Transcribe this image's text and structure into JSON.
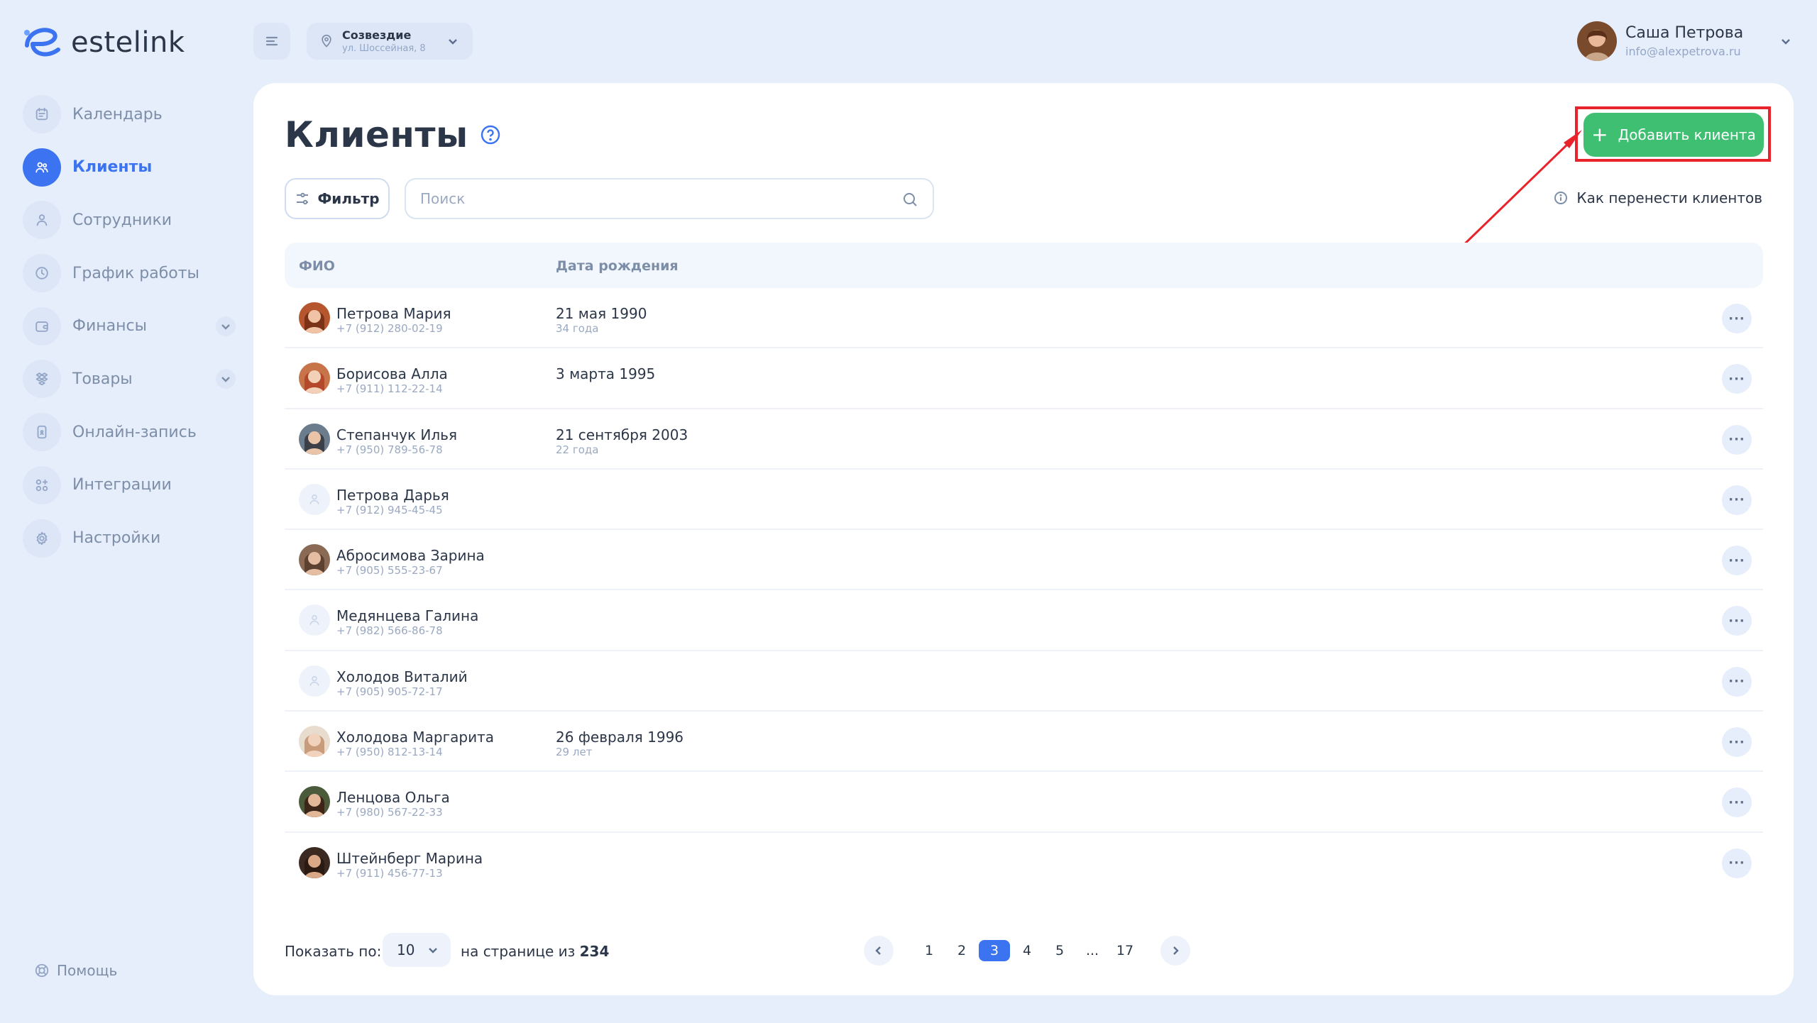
{
  "app": {
    "name": "estelink"
  },
  "sidebar": {
    "items": [
      {
        "label": "Календарь",
        "icon": "calendar-icon",
        "active": false,
        "expandable": false
      },
      {
        "label": "Клиенты",
        "icon": "users-icon",
        "active": true,
        "expandable": false
      },
      {
        "label": "Сотрудники",
        "icon": "user-icon",
        "active": false,
        "expandable": false
      },
      {
        "label": "График работы",
        "icon": "clock-icon",
        "active": false,
        "expandable": false
      },
      {
        "label": "Финансы",
        "icon": "wallet-icon",
        "active": false,
        "expandable": true
      },
      {
        "label": "Товары",
        "icon": "products-icon",
        "active": false,
        "expandable": true
      },
      {
        "label": "Онлайн-запись",
        "icon": "phone-icon",
        "active": false,
        "expandable": false
      },
      {
        "label": "Интеграции",
        "icon": "grid-plus-icon",
        "active": false,
        "expandable": false
      },
      {
        "label": "Настройки",
        "icon": "gear-icon",
        "active": false,
        "expandable": false
      }
    ],
    "help_label": "Помощь"
  },
  "header": {
    "location_name": "Созвездие",
    "location_address": "ул. Шоссейная, 8",
    "user_name": "Саша Петрова",
    "user_email": "info@alexpetrova.ru"
  },
  "page": {
    "title": "Клиенты",
    "add_button_label": "Добавить клиента",
    "filter_label": "Фильтр",
    "search_placeholder": "Поиск",
    "howto_label": "Как перенести клиентов"
  },
  "table": {
    "columns": [
      "ФИО",
      "Дата рождения"
    ],
    "rows": [
      {
        "name": "Петрова Мария",
        "phone": "+7 (912) 280-02-19",
        "birthdate": "21 мая 1990",
        "age": "34 года",
        "avatar": "photo"
      },
      {
        "name": "Борисова Алла",
        "phone": "+7 (911) 112-22-14",
        "birthdate": "3 марта 1995",
        "age": "",
        "avatar": "photo"
      },
      {
        "name": "Степанчук Илья",
        "phone": "+7 (950) 789-56-78",
        "birthdate": "21 сентября 2003",
        "age": "22 года",
        "avatar": "photo"
      },
      {
        "name": "Петрова Дарья",
        "phone": "+7 (912) 945-45-45",
        "birthdate": "",
        "age": "",
        "avatar": "placeholder"
      },
      {
        "name": "Абросимова Зарина",
        "phone": "+7 (905) 555-23-67",
        "birthdate": "",
        "age": "",
        "avatar": "photo"
      },
      {
        "name": "Медянцева Галина",
        "phone": "+7 (982) 566-86-78",
        "birthdate": "",
        "age": "",
        "avatar": "placeholder"
      },
      {
        "name": "Холодов Виталий",
        "phone": "+7 (905) 905-72-17",
        "birthdate": "",
        "age": "",
        "avatar": "placeholder"
      },
      {
        "name": "Холодова Маргарита",
        "phone": "+7 (950) 812-13-14",
        "birthdate": "26 февраля 1996",
        "age": "29 лет",
        "avatar": "photo"
      },
      {
        "name": "Ленцова Ольга",
        "phone": "+7 (980) 567-22-33",
        "birthdate": "",
        "age": "",
        "avatar": "photo"
      },
      {
        "name": "Штейнберг Марина",
        "phone": "+7 (911) 456-77-13",
        "birthdate": "",
        "age": "",
        "avatar": "photo"
      }
    ],
    "row_action": "···"
  },
  "footer": {
    "show_label": "Показать по:",
    "per_page": "10",
    "on_page_label": "на странице из",
    "total": "234",
    "pages": [
      "1",
      "2",
      "3",
      "4",
      "5",
      "...",
      "17"
    ],
    "current_page": "3"
  },
  "colors": {
    "accent": "#3b73f0",
    "add_button": "#3fbf72",
    "annotation": "#e8232b",
    "background": "#e6eefb"
  }
}
